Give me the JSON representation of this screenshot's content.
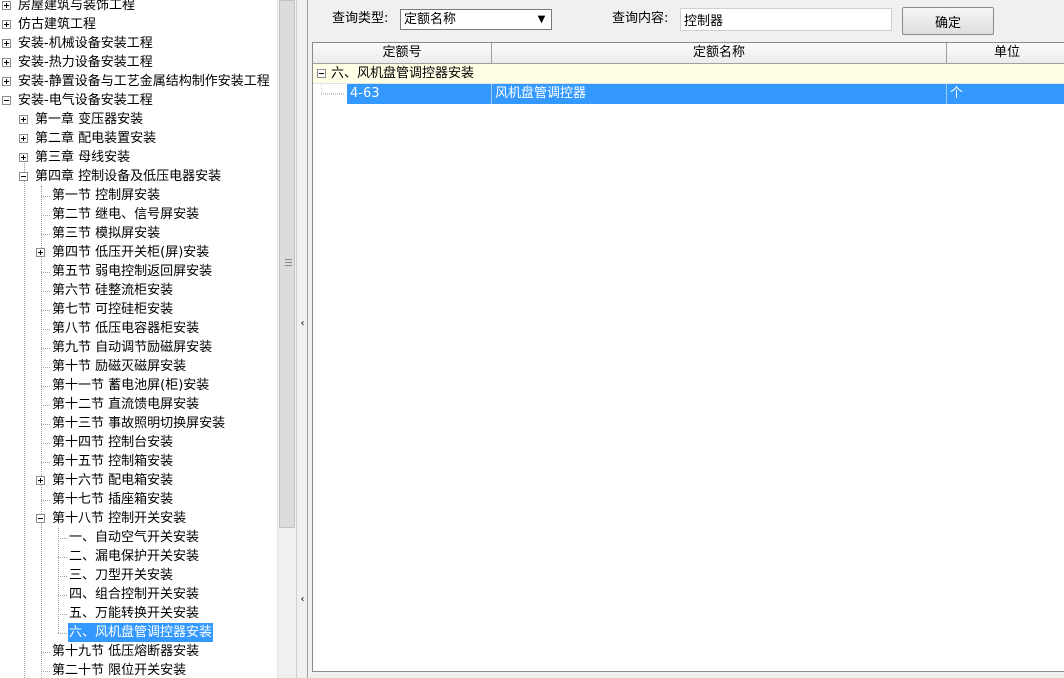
{
  "tree": {
    "items": [
      {
        "label": "房屋建筑与装饰工程"
      },
      {
        "label": "仿古建筑工程"
      },
      {
        "label": "安装-机械设备安装工程"
      },
      {
        "label": "安装-热力设备安装工程"
      },
      {
        "label": "安装-静置设备与工艺金属结构制作安装工程"
      },
      {
        "label": "安装-电气设备安装工程"
      },
      {
        "label": "第一章  变压器安装"
      },
      {
        "label": "第二章  配电装置安装"
      },
      {
        "label": "第三章  母线安装"
      },
      {
        "label": "第四章  控制设备及低压电器安装"
      },
      {
        "label": "第一节  控制屏安装"
      },
      {
        "label": "第二节  继电、信号屏安装"
      },
      {
        "label": "第三节  模拟屏安装"
      },
      {
        "label": "第四节  低压开关柜(屏)安装"
      },
      {
        "label": "第五节  弱电控制返回屏安装"
      },
      {
        "label": "第六节  硅整流柜安装"
      },
      {
        "label": "第七节  可控硅柜安装"
      },
      {
        "label": "第八节  低压电容器柜安装"
      },
      {
        "label": "第九节  自动调节励磁屏安装"
      },
      {
        "label": "第十节  励磁灭磁屏安装"
      },
      {
        "label": "第十一节  蓄电池屏(柜)安装"
      },
      {
        "label": "第十二节  直流馈电屏安装"
      },
      {
        "label": "第十三节  事故照明切换屏安装"
      },
      {
        "label": "第十四节  控制台安装"
      },
      {
        "label": "第十五节  控制箱安装"
      },
      {
        "label": "第十六节  配电箱安装"
      },
      {
        "label": "第十七节  插座箱安装"
      },
      {
        "label": "第十八节  控制开关安装"
      },
      {
        "label": "一、自动空气开关安装"
      },
      {
        "label": "二、漏电保护开关安装"
      },
      {
        "label": "三、刀型开关安装"
      },
      {
        "label": "四、组合控制开关安装"
      },
      {
        "label": "五、万能转换开关安装"
      },
      {
        "label": "六、风机盘管调控器安装"
      },
      {
        "label": "第十九节  低压熔断器安装"
      },
      {
        "label": "第二十节  限位开关安装"
      }
    ]
  },
  "query": {
    "type_label": "查询类型:",
    "type_value": "定额名称",
    "content_label": "查询内容:",
    "content_value": "控制器",
    "confirm_label": "确定"
  },
  "grid": {
    "columns": [
      "定额号",
      "定额名称",
      "单位"
    ],
    "group_label": "六、风机盘管调控器安装",
    "rows": [
      {
        "code": "4-63",
        "name": "风机盘管调控器",
        "unit": "个"
      }
    ]
  },
  "colors": {
    "selection": "#3399ff",
    "group_row_bg": "#ffffe6"
  }
}
